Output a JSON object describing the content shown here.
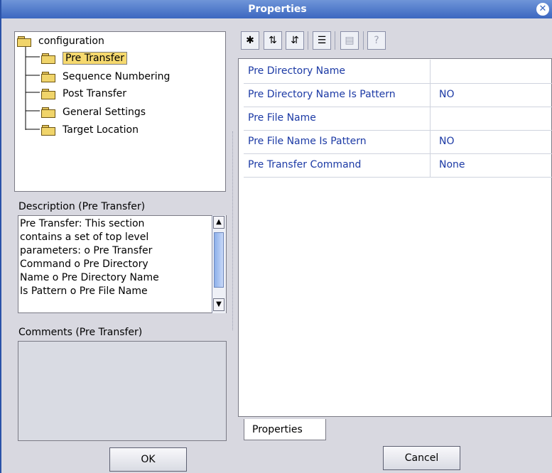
{
  "window": {
    "title": "Properties"
  },
  "tree": {
    "root": "configuration",
    "items": [
      {
        "label": "Pre Transfer",
        "selected": true
      },
      {
        "label": "Sequence Numbering"
      },
      {
        "label": "Post Transfer"
      },
      {
        "label": "General Settings"
      },
      {
        "label": "Target Location"
      }
    ]
  },
  "description": {
    "label": "Description (Pre Transfer)",
    "lines": [
      "Pre Transfer: This section",
      "contains a set of top level",
      "parameters:  o Pre Transfer",
      "Command   o Pre Directory",
      "Name   o Pre Directory Name",
      "Is Pattern   o Pre File Name"
    ]
  },
  "comments": {
    "label": "Comments (Pre Transfer)"
  },
  "toolbar": {
    "icons": [
      "collapse-all-icon",
      "sort-alpha-icon",
      "sort-category-icon",
      "checklist-icon",
      "table-icon",
      "help-icon"
    ]
  },
  "grid": {
    "rows": [
      {
        "name": "Pre Directory Name",
        "value": ""
      },
      {
        "name": "Pre Directory Name Is Pattern",
        "value": "NO"
      },
      {
        "name": "Pre File Name",
        "value": ""
      },
      {
        "name": "Pre File Name Is Pattern",
        "value": "NO"
      },
      {
        "name": "Pre Transfer Command",
        "value": "None"
      }
    ],
    "tab": "Properties"
  },
  "buttons": {
    "ok": "OK",
    "cancel": "Cancel"
  }
}
